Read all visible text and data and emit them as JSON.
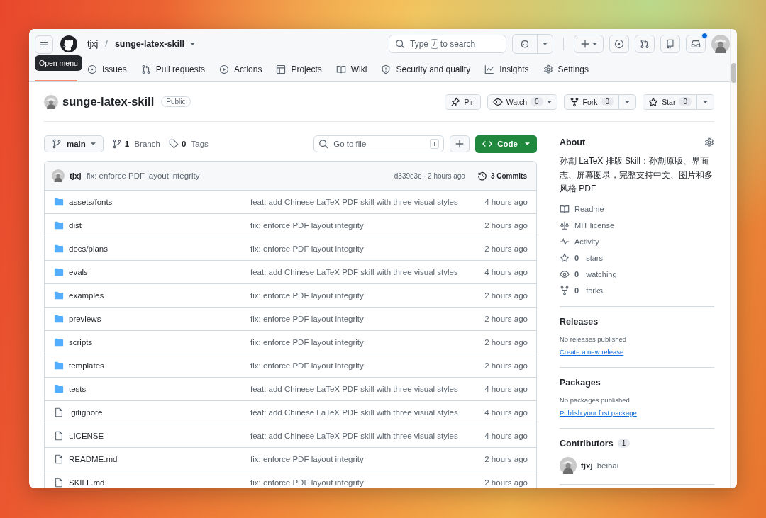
{
  "header": {
    "owner": "tjxj",
    "separator": "/",
    "repo": "sunge-latex-skill",
    "search": {
      "before": "Type",
      "key": "/",
      "after": "to search"
    },
    "inbox_unread": true
  },
  "tooltip": "Open menu",
  "tabs": [
    {
      "selected": true
    },
    {
      "label": "Issues",
      "selected": false
    },
    {
      "label": "Pull requests",
      "selected": false
    },
    {
      "label": "Actions",
      "selected": false
    },
    {
      "label": "Projects",
      "selected": false
    },
    {
      "label": "Wiki",
      "selected": false
    },
    {
      "label": "Security and quality",
      "selected": false
    },
    {
      "label": "Insights",
      "selected": false
    },
    {
      "label": "Settings",
      "selected": false
    }
  ],
  "repo": {
    "name": "sunge-latex-skill",
    "visibility": "Public"
  },
  "repo_actions": [
    {
      "kind": "plain",
      "label": "Pin"
    },
    {
      "kind": "caret",
      "label": "Watch",
      "count": "0"
    },
    {
      "kind": "split",
      "label": "Fork",
      "count": "0"
    },
    {
      "kind": "split",
      "label": "Star",
      "count": "0"
    }
  ],
  "toolbar": {
    "branch": "main",
    "branch_count": "1",
    "branch_label": "Branch",
    "tag_count": "0",
    "tag_label": "Tags",
    "go_to_file": {
      "placeholder": "Go to file",
      "key": "T"
    },
    "code_button": "Code"
  },
  "latest_commit": {
    "author": "tjxj",
    "message": "fix: enforce PDF layout integrity",
    "hash_time": "d339e3c · 2 hours ago",
    "commits": "3 Commits"
  },
  "files": [
    {
      "kind": "folder",
      "name": "assets/fonts",
      "message": "feat: add Chinese LaTeX PDF skill with three visual styles",
      "time": "4 hours ago"
    },
    {
      "kind": "folder",
      "name": "dist",
      "message": "fix: enforce PDF layout integrity",
      "time": "2 hours ago"
    },
    {
      "kind": "folder",
      "name": "docs/plans",
      "message": "fix: enforce PDF layout integrity",
      "time": "2 hours ago"
    },
    {
      "kind": "folder",
      "name": "evals",
      "message": "feat: add Chinese LaTeX PDF skill with three visual styles",
      "time": "4 hours ago"
    },
    {
      "kind": "folder",
      "name": "examples",
      "message": "fix: enforce PDF layout integrity",
      "time": "2 hours ago"
    },
    {
      "kind": "folder",
      "name": "previews",
      "message": "fix: enforce PDF layout integrity",
      "time": "2 hours ago"
    },
    {
      "kind": "folder",
      "name": "scripts",
      "message": "fix: enforce PDF layout integrity",
      "time": "2 hours ago"
    },
    {
      "kind": "folder",
      "name": "templates",
      "message": "fix: enforce PDF layout integrity",
      "time": "2 hours ago"
    },
    {
      "kind": "folder",
      "name": "tests",
      "message": "feat: add Chinese LaTeX PDF skill with three visual styles",
      "time": "4 hours ago"
    },
    {
      "kind": "file",
      "name": ".gitignore",
      "message": "feat: add Chinese LaTeX PDF skill with three visual styles",
      "time": "4 hours ago"
    },
    {
      "kind": "file",
      "name": "LICENSE",
      "message": "feat: add Chinese LaTeX PDF skill with three visual styles",
      "time": "4 hours ago"
    },
    {
      "kind": "file",
      "name": "README.md",
      "message": "fix: enforce PDF layout integrity",
      "time": "2 hours ago"
    },
    {
      "kind": "file",
      "name": "SKILL.md",
      "message": "fix: enforce PDF layout integrity",
      "time": "2 hours ago"
    }
  ],
  "about": {
    "title": "About",
    "description": "孙劏 LaTeX 排版 Skill：孙劏原版、界面志、屏幕图录，完整支持中文、图片和多风格 PDF",
    "links": [
      {
        "label": "Readme"
      },
      {
        "label": "MIT license"
      },
      {
        "label": "Activity"
      },
      {
        "count": "0",
        "label": "stars"
      },
      {
        "count": "0",
        "label": "watching"
      },
      {
        "count": "0",
        "label": "forks"
      }
    ]
  },
  "releases": {
    "title": "Releases",
    "note": "No releases published",
    "link": "Create a new release"
  },
  "packages": {
    "title": "Packages",
    "note": "No packages published",
    "link": "Publish your first package"
  },
  "contributors": {
    "title": "Contributors",
    "count": "1",
    "people": [
      {
        "login": "tjxj",
        "name": "beihai"
      }
    ]
  }
}
